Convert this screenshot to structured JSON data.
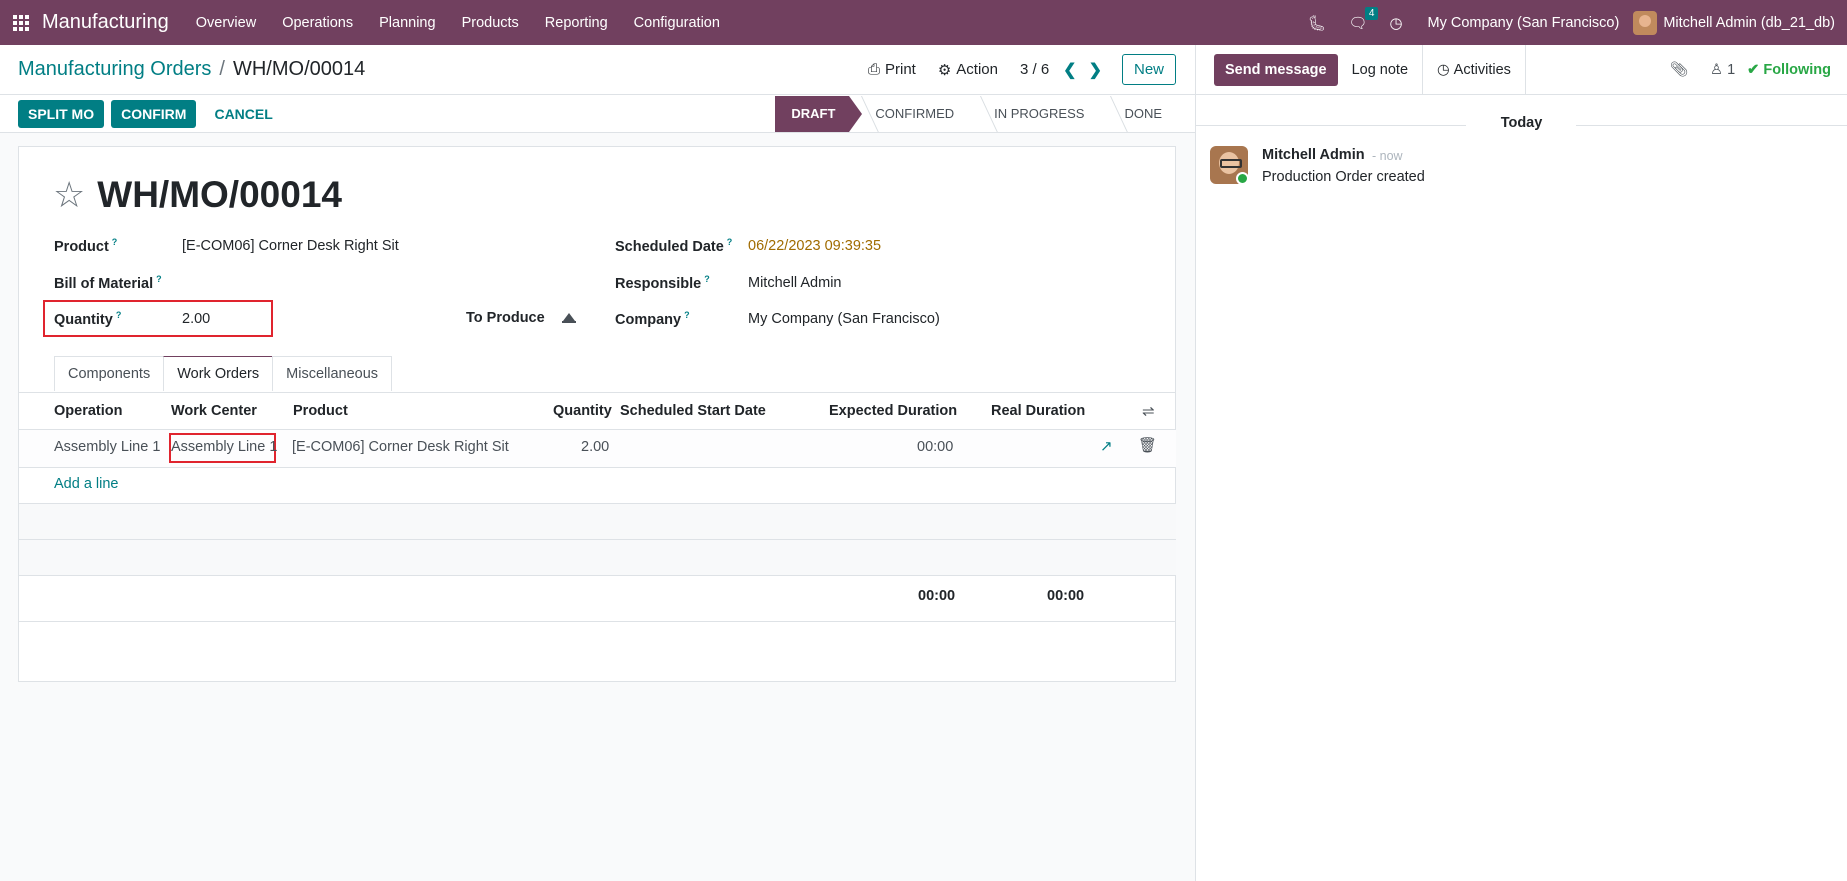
{
  "navbar": {
    "brand": "Manufacturing",
    "menu": [
      "Overview",
      "Operations",
      "Planning",
      "Products",
      "Reporting",
      "Configuration"
    ],
    "messages_count": "4",
    "company": "My Company (San Francisco)",
    "user": "Mitchell Admin (db_21_db)"
  },
  "control": {
    "breadcrumb_parent": "Manufacturing Orders",
    "breadcrumb_sep": "/",
    "breadcrumb_current": "WH/MO/00014",
    "print_label": "Print",
    "action_label": "Action",
    "pager": "3 / 6",
    "new_label": "New"
  },
  "statusbar": {
    "buttons": [
      "SPLIT MO",
      "CONFIRM"
    ],
    "cancel_label": "CANCEL",
    "stages": [
      "DRAFT",
      "CONFIRMED",
      "IN PROGRESS",
      "DONE"
    ],
    "active_stage": "DRAFT"
  },
  "form": {
    "title": "WH/MO/00014",
    "product_label": "Product",
    "product_value": "[E-COM06] Corner Desk Right Sit",
    "bom_label": "Bill of Material",
    "quantity_label": "Quantity",
    "quantity_value": "2.00",
    "to_produce_label": "To Produce",
    "scheduled_label": "Scheduled Date",
    "scheduled_value": "06/22/2023 09:39:35",
    "responsible_label": "Responsible",
    "responsible_value": "Mitchell Admin",
    "company_label": "Company",
    "company_value": "My Company (San Francisco)",
    "help_mark": "?"
  },
  "tabs": [
    "Components",
    "Work Orders",
    "Miscellaneous"
  ],
  "active_tab": "Work Orders",
  "workorders": {
    "columns": [
      "Operation",
      "Work Center",
      "Product",
      "Quantity",
      "Scheduled Start Date",
      "Expected Duration",
      "Real Duration"
    ],
    "rows": [
      {
        "operation": "Assembly Line 1",
        "work_center": "Assembly Line 1",
        "product": "[E-COM06] Corner Desk Right Sit",
        "quantity": "2.00",
        "scheduled_start": "",
        "expected_duration": "00:00",
        "real_duration": ""
      }
    ],
    "add_line": "Add a line",
    "total_expected": "00:00",
    "total_real": "00:00"
  },
  "chatter": {
    "send_message": "Send message",
    "log_note": "Log note",
    "activities": "Activities",
    "followers_count": "1",
    "following": "Following",
    "today": "Today",
    "message": {
      "author": "Mitchell Admin",
      "time": "- now",
      "body": "Production Order created"
    }
  },
  "colors": {
    "brand": "#71405f",
    "accent": "#017e84",
    "highlight": "#e0242e",
    "date": "#a06b00",
    "following": "#28a745"
  }
}
